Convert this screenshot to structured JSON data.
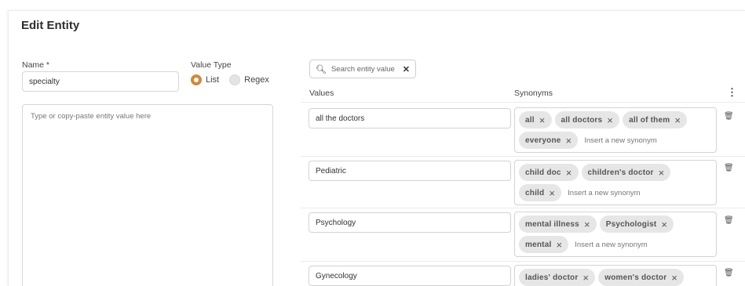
{
  "page_title": "Edit Entity",
  "name_field": {
    "label": "Name *",
    "value": "specialty"
  },
  "value_type": {
    "label": "Value Type",
    "options": [
      "List",
      "Regex"
    ],
    "selected": "List"
  },
  "paste_area": {
    "placeholder": "Type or copy-paste entity value here"
  },
  "search": {
    "placeholder": "Search entity value"
  },
  "columns": {
    "values": "Values",
    "synonyms": "Synonyms"
  },
  "rows": [
    {
      "value": "all the doctors",
      "synonyms": [
        "all",
        "all doctors",
        "all of them",
        "everyone"
      ],
      "new_placeholder": "Insert a new synonym"
    },
    {
      "value": "Pediatric",
      "synonyms": [
        "child doc",
        "children's doctor",
        "child"
      ],
      "new_placeholder": "Insert a new synonym"
    },
    {
      "value": "Psychology",
      "synonyms": [
        "mental illness",
        "Psychologist",
        "mental"
      ],
      "new_placeholder": "Insert a new synonym"
    },
    {
      "value": "Gynecology",
      "synonyms": [
        "ladies' doctor",
        "women's doctor"
      ],
      "new_placeholder": ""
    }
  ],
  "colors": {
    "accent": "#d08a3a",
    "chip_bg": "#e6e6e6"
  }
}
